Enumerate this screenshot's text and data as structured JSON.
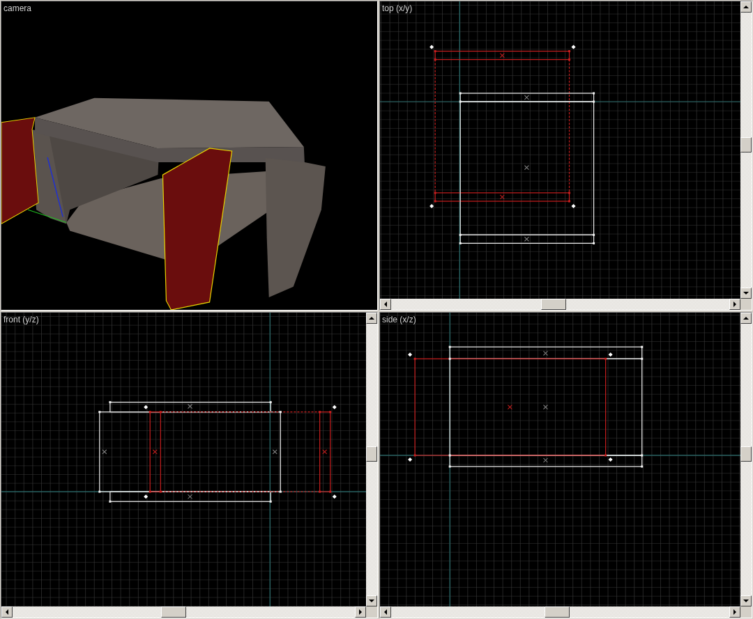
{
  "viewports": [
    {
      "kind": "camera",
      "label": "camera"
    },
    {
      "kind": "top",
      "label": "top (x/y)"
    },
    {
      "kind": "front",
      "label": "front (y/z)"
    },
    {
      "kind": "side",
      "label": "side (x/z)"
    }
  ]
}
